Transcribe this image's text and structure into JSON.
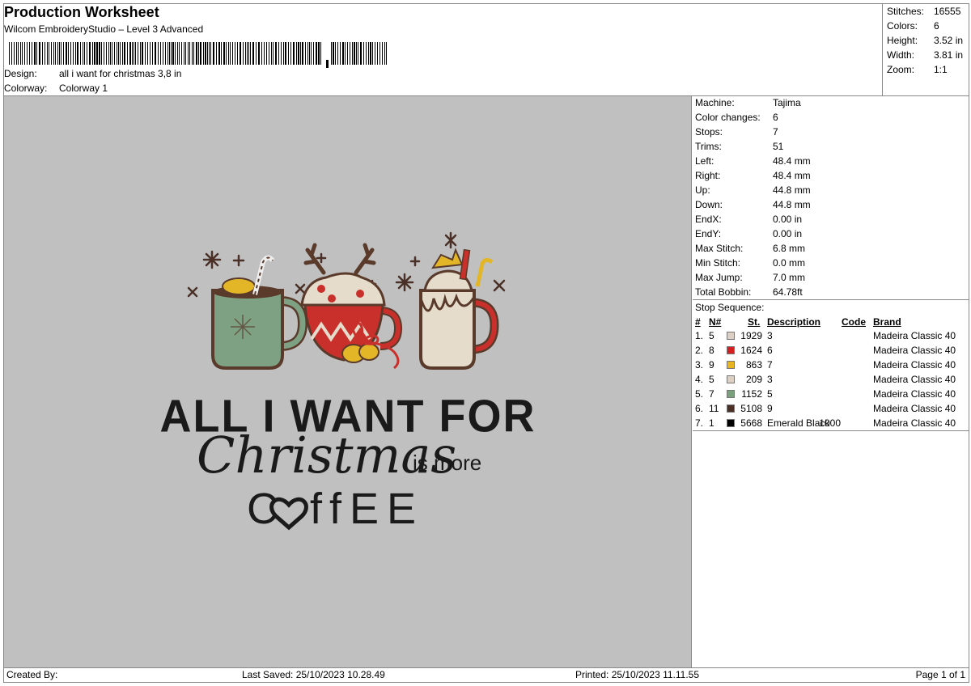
{
  "header": {
    "title": "Production Worksheet",
    "subtitle": "Wilcom EmbroideryStudio – Level 3 Advanced",
    "design_label": "Design:",
    "design_value": "all i want for christmas 3,8 in",
    "colorway_label": "Colorway:",
    "colorway_value": "Colorway 1"
  },
  "stats": [
    {
      "label": "Stitches:",
      "value": "16555"
    },
    {
      "label": "Colors:",
      "value": "6"
    },
    {
      "label": "Height:",
      "value": "3.52 in"
    },
    {
      "label": "Width:",
      "value": "3.81 in"
    },
    {
      "label": "Zoom:",
      "value": "1:1"
    }
  ],
  "design": {
    "line1": "ALL I WANT FOR",
    "line2": "Christmas",
    "line2b": "is more",
    "line3a": "C",
    "line3b": "ffEE",
    "colors": {
      "bg": "#c0c0c0",
      "thread_black": "#1a1a1a",
      "green": "#7fa183",
      "red": "#c9302c",
      "cream": "#e6dccb",
      "gold": "#e3b628",
      "brown": "#5a3a2a"
    }
  },
  "machine_info": [
    {
      "label": "Machine:",
      "value": "Tajima"
    },
    {
      "label": "Color changes:",
      "value": "6"
    },
    {
      "label": "Stops:",
      "value": "7"
    },
    {
      "label": "Trims:",
      "value": "51"
    },
    {
      "label": "Left:",
      "value": "48.4 mm"
    },
    {
      "label": "Right:",
      "value": "48.4 mm"
    },
    {
      "label": "Up:",
      "value": "44.8 mm"
    },
    {
      "label": "Down:",
      "value": "44.8 mm"
    },
    {
      "label": "EndX:",
      "value": "0.00 in"
    },
    {
      "label": "EndY:",
      "value": "0.00 in"
    },
    {
      "label": "Max Stitch:",
      "value": "6.8 mm"
    },
    {
      "label": "Min Stitch:",
      "value": "0.0 mm"
    },
    {
      "label": "Max Jump:",
      "value": "7.0 mm"
    },
    {
      "label": "Total Bobbin:",
      "value": "64.78ft"
    }
  ],
  "stop_sequence": {
    "title": "Stop Sequence:",
    "headers": {
      "num": "#",
      "n": "N#",
      "st": "St.",
      "desc": "Description",
      "code": "Code",
      "brand": "Brand"
    },
    "rows": [
      {
        "num": "1.",
        "n": "5",
        "color": "#dccfc4",
        "st": "1929",
        "desc": "3",
        "code": "",
        "brand": "Madeira Classic 40"
      },
      {
        "num": "2.",
        "n": "8",
        "color": "#d42020",
        "st": "1624",
        "desc": "6",
        "code": "",
        "brand": "Madeira Classic 40"
      },
      {
        "num": "3.",
        "n": "9",
        "color": "#e8b520",
        "st": "863",
        "desc": "7",
        "code": "",
        "brand": "Madeira Classic 40"
      },
      {
        "num": "4.",
        "n": "5",
        "color": "#dccfc4",
        "st": "209",
        "desc": "3",
        "code": "",
        "brand": "Madeira Classic 40"
      },
      {
        "num": "5.",
        "n": "7",
        "color": "#7aa07c",
        "st": "1152",
        "desc": "5",
        "code": "",
        "brand": "Madeira Classic 40"
      },
      {
        "num": "6.",
        "n": "11",
        "color": "#4a3026",
        "st": "5108",
        "desc": "9",
        "code": "",
        "brand": "Madeira Classic 40"
      },
      {
        "num": "7.",
        "n": "1",
        "color": "#000000",
        "st": "5668",
        "desc": "Emerald Black",
        "code": "1000",
        "brand": "Madeira Classic 40"
      }
    ]
  },
  "footer": {
    "created_by": "Created By:",
    "last_saved": "Last Saved: 25/10/2023 10.28.49",
    "printed": "Printed: 25/10/2023 11.11.55",
    "page": "Page 1 of 1"
  }
}
